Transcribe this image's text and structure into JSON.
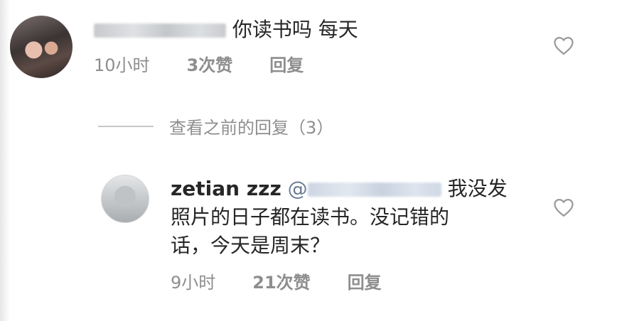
{
  "comment": {
    "text": "你读书吗 每天",
    "time": "10小时",
    "likes": "3次赞",
    "reply_label": "回复"
  },
  "view_previous": "查看之前的回复（3）",
  "reply": {
    "username": "zetian zzz",
    "mention_prefix": "@",
    "text_line1": "我没发",
    "text_line2": "照片的日子都在读书。没记错的",
    "text_line3": "话，今天是周末？",
    "time": "9小时",
    "likes": "21次赞",
    "reply_label": "回复"
  },
  "icons": {
    "like": "heart-outline-icon"
  }
}
